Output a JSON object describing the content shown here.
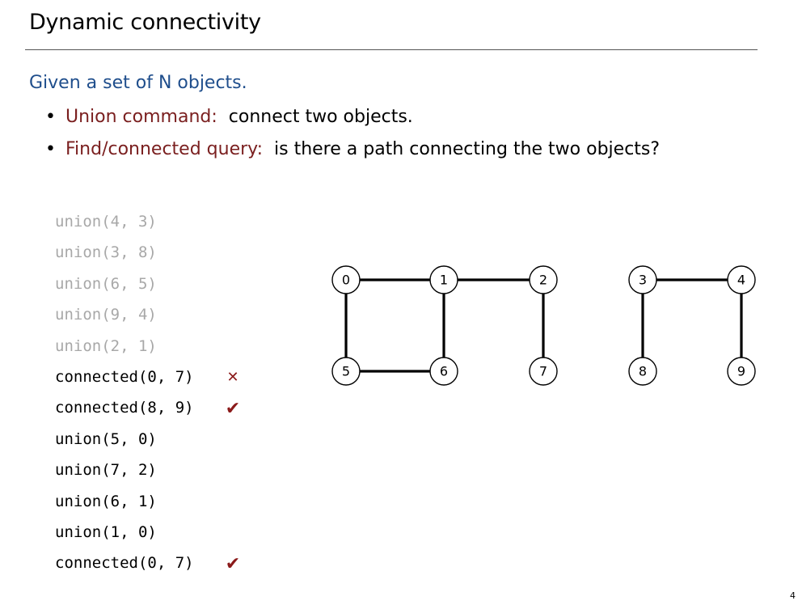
{
  "slide": {
    "title": "Dynamic connectivity",
    "lead": "Given a set of N objects.",
    "bullets": [
      {
        "term": "Union command:",
        "text": "connect two objects."
      },
      {
        "term": "Find/connected query:",
        "text": "is there a path connecting the two objects?"
      }
    ],
    "page_number": "4"
  },
  "operations": [
    {
      "text": "union(4, 3)",
      "state": "faded",
      "mark": ""
    },
    {
      "text": "union(3, 8)",
      "state": "faded",
      "mark": ""
    },
    {
      "text": "union(6, 5)",
      "state": "faded",
      "mark": ""
    },
    {
      "text": "union(9, 4)",
      "state": "faded",
      "mark": ""
    },
    {
      "text": "union(2, 1)",
      "state": "faded",
      "mark": ""
    },
    {
      "text": "connected(0, 7)",
      "state": "active",
      "mark": "✕"
    },
    {
      "text": "connected(8, 9)",
      "state": "active",
      "mark": "✔"
    },
    {
      "text": "union(5, 0)",
      "state": "active",
      "mark": ""
    },
    {
      "text": "union(7, 2)",
      "state": "active",
      "mark": ""
    },
    {
      "text": "union(6, 1)",
      "state": "active",
      "mark": ""
    },
    {
      "text": "union(1, 0)",
      "state": "active",
      "mark": ""
    },
    {
      "text": "connected(0, 7)",
      "state": "active",
      "mark": "✔"
    }
  ],
  "graph": {
    "nodes": [
      "0",
      "1",
      "2",
      "3",
      "4",
      "5",
      "6",
      "7",
      "8",
      "9"
    ],
    "edges": [
      [
        "0",
        "1"
      ],
      [
        "1",
        "2"
      ],
      [
        "3",
        "4"
      ],
      [
        "0",
        "5"
      ],
      [
        "5",
        "6"
      ],
      [
        "1",
        "6"
      ],
      [
        "2",
        "7"
      ],
      [
        "3",
        "8"
      ],
      [
        "4",
        "9"
      ]
    ]
  },
  "colors": {
    "lead": "#1f4e8c",
    "term": "#7a1f1f",
    "mark": "#8b1a1a",
    "faded": "#a8a8a8"
  }
}
